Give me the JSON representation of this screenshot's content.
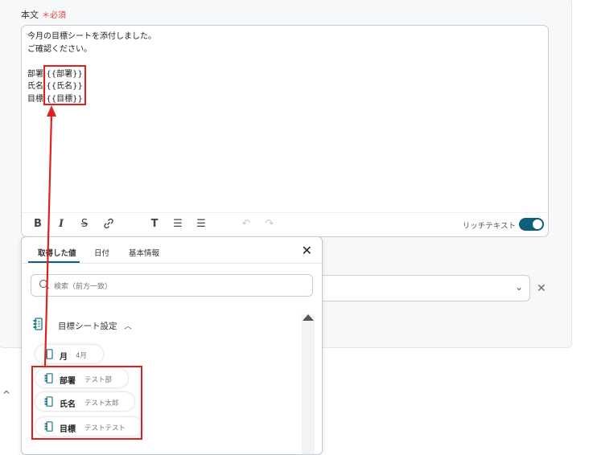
{
  "body_field": {
    "label": "本文",
    "required": "＊必須",
    "lines": [
      "今月の目標シートを添付しました。",
      "ご確認ください。",
      "",
      "部署:{{部署}}",
      "氏名:{{氏名}}",
      "目標:{{目標}}"
    ]
  },
  "toolbar": {
    "bold": "B",
    "italic": "I",
    "strike": "S",
    "link": "🔗",
    "text_size": "T",
    "bullet_list": "☰",
    "ordered_list": "☰",
    "undo": "↶",
    "redo": "↷",
    "rich_text_label": "リッチテキスト",
    "rich_text_enabled": true
  },
  "picker": {
    "tabs": [
      "取得した値",
      "日付",
      "基本情報"
    ],
    "active_tab": 0,
    "search_placeholder": "検索（前方一致）",
    "group": {
      "title": "目標シート設定",
      "items": [
        {
          "name": "月",
          "value": "4月"
        },
        {
          "name": "部署",
          "value": "テスト部"
        },
        {
          "name": "氏名",
          "value": "テスト太郎"
        },
        {
          "name": "目標",
          "value": "テストテスト"
        }
      ]
    }
  },
  "colors": {
    "accent": "#0d5f7c",
    "highlight": "#e0201d",
    "required": "#e5423a",
    "item_icon": "#1a7a83"
  },
  "icons": {
    "close": "close-icon",
    "search": "search-icon",
    "group": "sheet-icon",
    "collapse": "chevron-up-icon",
    "select": "chevron-down-icon",
    "remove": "close-icon"
  },
  "background": {
    "collapse_caret": "^",
    "select_caret": "⌄",
    "remove_x": "✕"
  }
}
